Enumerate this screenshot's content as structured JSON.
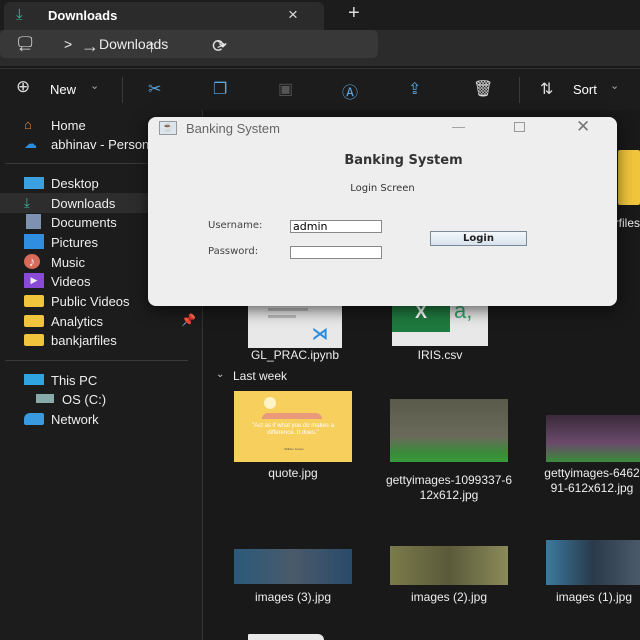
{
  "tab": {
    "title": "Downloads",
    "close": "×",
    "new": "+"
  },
  "nav": {
    "back": "←",
    "forward": "→",
    "up": "↑",
    "refresh": "⟳",
    "breadcrumb": [
      "Downloads"
    ],
    "sep": ">"
  },
  "toolbar": {
    "new_label": "New",
    "sort_label": "Sort",
    "chev": "⌄"
  },
  "sidebar": {
    "items": [
      {
        "label": "Home"
      },
      {
        "label": "abhinav - Personal"
      },
      {
        "label": "Desktop"
      },
      {
        "label": "Downloads"
      },
      {
        "label": "Documents"
      },
      {
        "label": "Pictures"
      },
      {
        "label": "Music"
      },
      {
        "label": "Videos"
      },
      {
        "label": "Public Videos"
      },
      {
        "label": "Analytics"
      },
      {
        "label": "bankjarfiles"
      },
      {
        "label": "This PC"
      },
      {
        "label": "OS (C:)"
      },
      {
        "label": "Network"
      }
    ]
  },
  "content": {
    "partial_folder_label": "bankjarfiles",
    "files_top": [
      {
        "name": "GL_PRAC.ipynb"
      },
      {
        "name": "IRIS.csv"
      }
    ],
    "group": "Last week",
    "files": [
      {
        "name": "quote.jpg",
        "quote": "\"Act as if what you do makes a difference. It does.\"",
        "author": "- William James"
      },
      {
        "name": "gettyimages-1099337-612x612.jpg"
      },
      {
        "name": "gettyimages-646291-612x612.jpg"
      },
      {
        "name": "images (3).jpg"
      },
      {
        "name": "images (2).jpg"
      },
      {
        "name": "images (1).jpg"
      }
    ]
  },
  "dialog": {
    "window_title": "Banking System",
    "heading": "Banking System",
    "subheading": "Login Screen",
    "username_label": "Username:",
    "username_value": "admin",
    "password_label": "Password:",
    "password_value": "",
    "login_label": "Login"
  },
  "colors": {
    "accent": "#3fb6a0",
    "folder": "#f0c43c",
    "icon_blue": "#5aa6e0"
  }
}
